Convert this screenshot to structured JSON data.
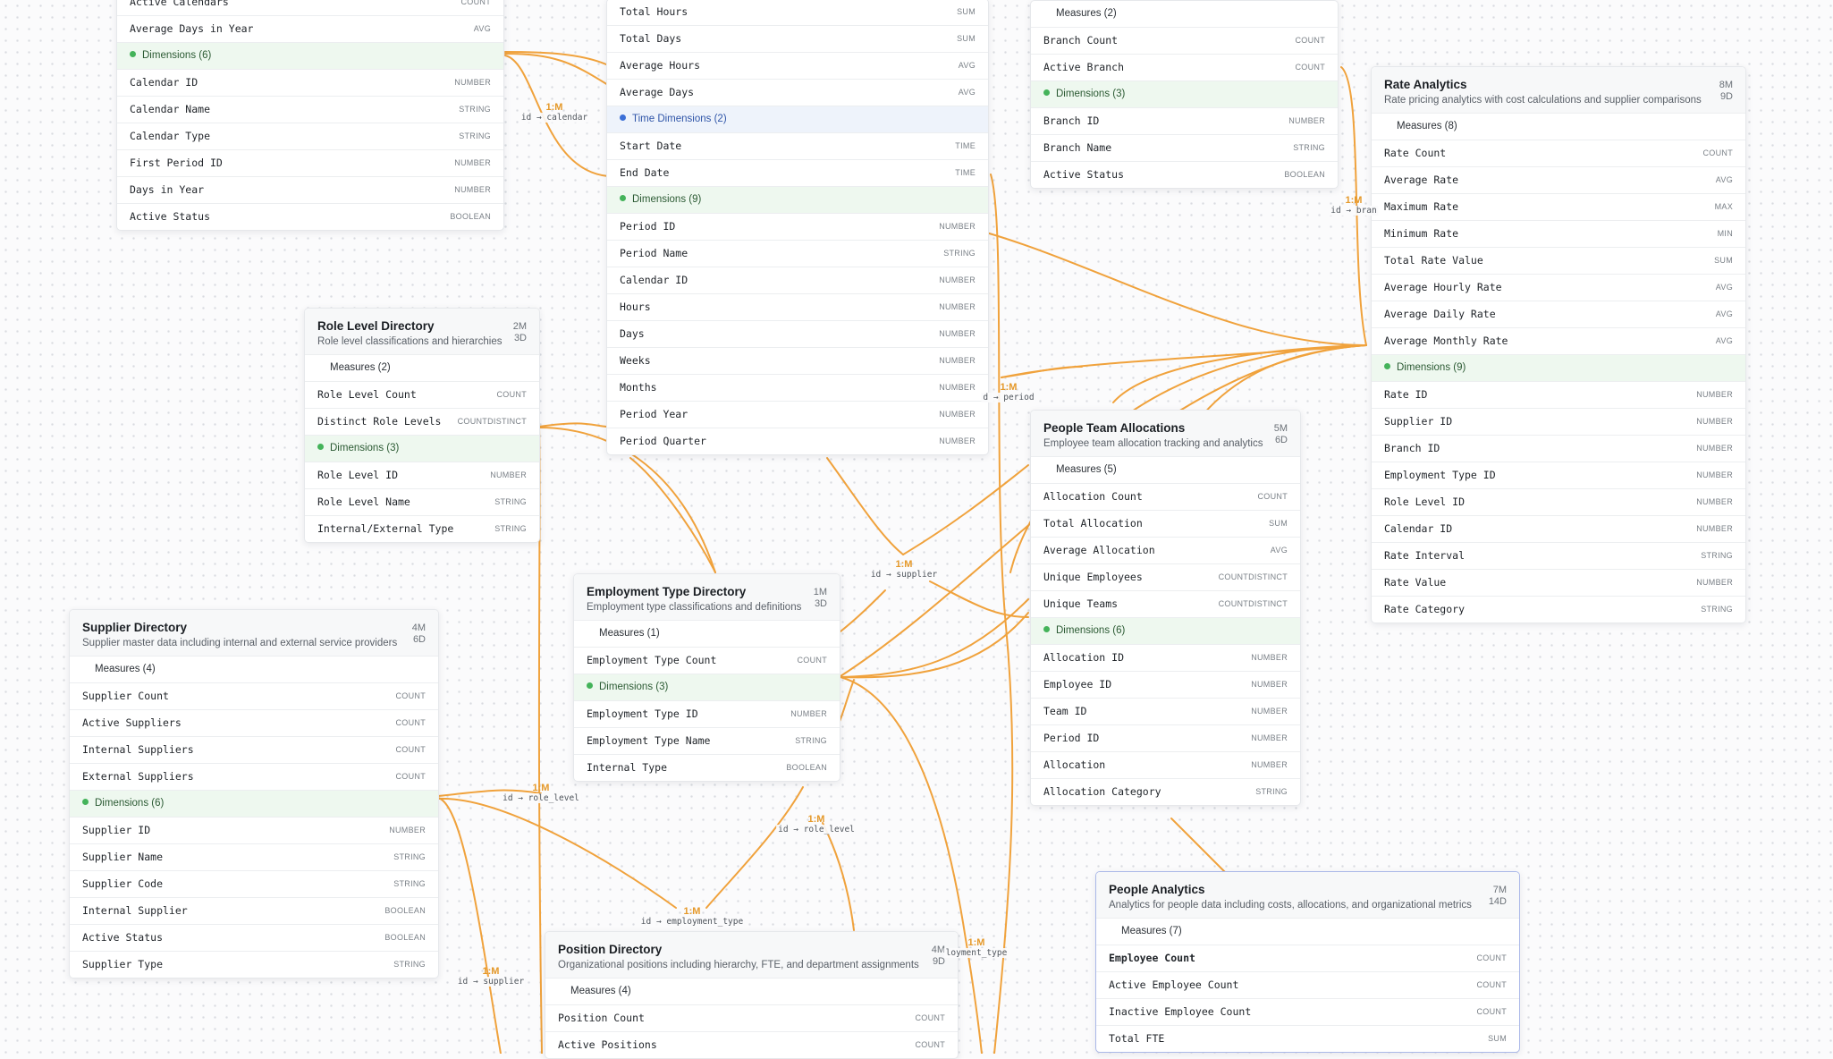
{
  "colors": {
    "edge": "#f0a23c",
    "card_label": "#e5992a",
    "dimension_dot": "#44b35a",
    "time_dot": "#3b6fd6"
  },
  "entities": [
    {
      "id": "calendars",
      "title": "",
      "description": "",
      "counts": [
        "",
        ""
      ],
      "sections": [
        {
          "kind": "plain",
          "label": "",
          "rows": [
            {
              "name": "Active Calendars",
              "type": "COUNT"
            },
            {
              "name": "Average Days in Year",
              "type": "AVG"
            }
          ]
        },
        {
          "kind": "dim",
          "label": "Dimensions (6)",
          "rows": [
            {
              "name": "Calendar ID",
              "type": "NUMBER"
            },
            {
              "name": "Calendar Name",
              "type": "STRING"
            },
            {
              "name": "Calendar Type",
              "type": "STRING"
            },
            {
              "name": "First Period ID",
              "type": "NUMBER"
            },
            {
              "name": "Days in Year",
              "type": "NUMBER"
            },
            {
              "name": "Active Status",
              "type": "BOOLEAN"
            }
          ]
        }
      ]
    },
    {
      "id": "periods",
      "title": "",
      "description": "",
      "counts": [
        "",
        ""
      ],
      "sections": [
        {
          "kind": "plain",
          "label": "",
          "rows": [
            {
              "name": "Total Hours",
              "type": "SUM"
            },
            {
              "name": "Total Days",
              "type": "SUM"
            },
            {
              "name": "Average Hours",
              "type": "AVG"
            },
            {
              "name": "Average Days",
              "type": "AVG"
            }
          ]
        },
        {
          "kind": "time",
          "label": "Time Dimensions (2)",
          "rows": [
            {
              "name": "Start Date",
              "type": "TIME"
            },
            {
              "name": "End Date",
              "type": "TIME"
            }
          ]
        },
        {
          "kind": "dim",
          "label": "Dimensions (9)",
          "rows": [
            {
              "name": "Period ID",
              "type": "NUMBER"
            },
            {
              "name": "Period Name",
              "type": "STRING"
            },
            {
              "name": "Calendar ID",
              "type": "NUMBER"
            },
            {
              "name": "Hours",
              "type": "NUMBER"
            },
            {
              "name": "Days",
              "type": "NUMBER"
            },
            {
              "name": "Weeks",
              "type": "NUMBER"
            },
            {
              "name": "Months",
              "type": "NUMBER"
            },
            {
              "name": "Period Year",
              "type": "NUMBER"
            },
            {
              "name": "Period Quarter",
              "type": "NUMBER"
            }
          ]
        }
      ]
    },
    {
      "id": "branches",
      "title": "",
      "description": "",
      "counts": [
        "",
        ""
      ],
      "sections": [
        {
          "kind": "plain",
          "label": "Measures (2)",
          "rows": [
            {
              "name": "Branch Count",
              "type": "COUNT"
            },
            {
              "name": "Active Branch",
              "type": "COUNT"
            }
          ]
        },
        {
          "kind": "dim",
          "label": "Dimensions (3)",
          "rows": [
            {
              "name": "Branch ID",
              "type": "NUMBER"
            },
            {
              "name": "Branch Name",
              "type": "STRING"
            },
            {
              "name": "Active Status",
              "type": "BOOLEAN"
            }
          ]
        }
      ]
    },
    {
      "id": "rate_analytics",
      "title": "Rate Analytics",
      "description": "Rate pricing analytics with cost calculations and supplier comparisons",
      "counts": [
        "8M",
        "9D"
      ],
      "sections": [
        {
          "kind": "plain",
          "label": "Measures (8)",
          "rows": [
            {
              "name": "Rate Count",
              "type": "COUNT"
            },
            {
              "name": "Average Rate",
              "type": "AVG"
            },
            {
              "name": "Maximum Rate",
              "type": "MAX"
            },
            {
              "name": "Minimum Rate",
              "type": "MIN"
            },
            {
              "name": "Total Rate Value",
              "type": "SUM"
            },
            {
              "name": "Average Hourly Rate",
              "type": "AVG"
            },
            {
              "name": "Average Daily Rate",
              "type": "AVG"
            },
            {
              "name": "Average Monthly Rate",
              "type": "AVG"
            }
          ]
        },
        {
          "kind": "dim",
          "label": "Dimensions (9)",
          "rows": [
            {
              "name": "Rate ID",
              "type": "NUMBER"
            },
            {
              "name": "Supplier ID",
              "type": "NUMBER"
            },
            {
              "name": "Branch ID",
              "type": "NUMBER"
            },
            {
              "name": "Employment Type ID",
              "type": "NUMBER"
            },
            {
              "name": "Role Level ID",
              "type": "NUMBER"
            },
            {
              "name": "Calendar ID",
              "type": "NUMBER"
            },
            {
              "name": "Rate Interval",
              "type": "STRING"
            },
            {
              "name": "Rate Value",
              "type": "NUMBER"
            },
            {
              "name": "Rate Category",
              "type": "STRING"
            }
          ]
        }
      ]
    },
    {
      "id": "role_levels",
      "title": "Role Level Directory",
      "description": "Role level classifications and hierarchies",
      "counts": [
        "2M",
        "3D"
      ],
      "sections": [
        {
          "kind": "plain",
          "label": "Measures (2)",
          "rows": [
            {
              "name": "Role Level Count",
              "type": "COUNT"
            },
            {
              "name": "Distinct Role Levels",
              "type": "COUNTDISTINCT"
            }
          ]
        },
        {
          "kind": "dim",
          "label": "Dimensions (3)",
          "rows": [
            {
              "name": "Role Level ID",
              "type": "NUMBER"
            },
            {
              "name": "Role Level Name",
              "type": "STRING"
            },
            {
              "name": "Internal/External Type",
              "type": "STRING"
            }
          ]
        }
      ]
    },
    {
      "id": "team_allocations",
      "title": "People Team Allocations",
      "description": "Employee team allocation tracking and analytics",
      "counts": [
        "5M",
        "6D"
      ],
      "sections": [
        {
          "kind": "plain",
          "label": "Measures (5)",
          "rows": [
            {
              "name": "Allocation Count",
              "type": "COUNT"
            },
            {
              "name": "Total Allocation",
              "type": "SUM"
            },
            {
              "name": "Average Allocation",
              "type": "AVG"
            },
            {
              "name": "Unique Employees",
              "type": "COUNTDISTINCT"
            },
            {
              "name": "Unique Teams",
              "type": "COUNTDISTINCT"
            }
          ]
        },
        {
          "kind": "dim",
          "label": "Dimensions (6)",
          "rows": [
            {
              "name": "Allocation ID",
              "type": "NUMBER"
            },
            {
              "name": "Employee ID",
              "type": "NUMBER"
            },
            {
              "name": "Team ID",
              "type": "NUMBER"
            },
            {
              "name": "Period ID",
              "type": "NUMBER"
            },
            {
              "name": "Allocation",
              "type": "NUMBER"
            },
            {
              "name": "Allocation Category",
              "type": "STRING"
            }
          ]
        }
      ]
    },
    {
      "id": "employment_types",
      "title": "Employment Type Directory",
      "description": "Employment type classifications and definitions",
      "counts": [
        "1M",
        "3D"
      ],
      "sections": [
        {
          "kind": "plain",
          "label": "Measures (1)",
          "rows": [
            {
              "name": "Employment Type Count",
              "type": "COUNT"
            }
          ]
        },
        {
          "kind": "dim",
          "label": "Dimensions (3)",
          "rows": [
            {
              "name": "Employment Type ID",
              "type": "NUMBER"
            },
            {
              "name": "Employment Type Name",
              "type": "STRING"
            },
            {
              "name": "Internal Type",
              "type": "BOOLEAN"
            }
          ]
        }
      ]
    },
    {
      "id": "suppliers",
      "title": "Supplier Directory",
      "description": "Supplier master data including internal and external service providers",
      "counts": [
        "4M",
        "6D"
      ],
      "sections": [
        {
          "kind": "plain",
          "label": "Measures (4)",
          "rows": [
            {
              "name": "Supplier Count",
              "type": "COUNT"
            },
            {
              "name": "Active Suppliers",
              "type": "COUNT"
            },
            {
              "name": "Internal Suppliers",
              "type": "COUNT"
            },
            {
              "name": "External Suppliers",
              "type": "COUNT"
            }
          ]
        },
        {
          "kind": "dim",
          "label": "Dimensions (6)",
          "rows": [
            {
              "name": "Supplier ID",
              "type": "NUMBER"
            },
            {
              "name": "Supplier Name",
              "type": "STRING"
            },
            {
              "name": "Supplier Code",
              "type": "STRING"
            },
            {
              "name": "Internal Supplier",
              "type": "BOOLEAN"
            },
            {
              "name": "Active Status",
              "type": "BOOLEAN"
            },
            {
              "name": "Supplier Type",
              "type": "STRING"
            }
          ]
        }
      ]
    },
    {
      "id": "positions",
      "title": "Position Directory",
      "description": "Organizational positions including hierarchy, FTE, and department assignments",
      "counts": [
        "4M",
        "9D"
      ],
      "sections": [
        {
          "kind": "plain",
          "label": "Measures (4)",
          "rows": [
            {
              "name": "Position Count",
              "type": "COUNT"
            },
            {
              "name": "Active Positions",
              "type": "COUNT"
            }
          ]
        }
      ]
    },
    {
      "id": "people_analytics",
      "title": "People Analytics",
      "description": "Analytics for people data including costs, allocations, and organizational metrics",
      "counts": [
        "7M",
        "14D"
      ],
      "selected": true,
      "sections": [
        {
          "kind": "plain",
          "label": "Measures (7)",
          "rows": [
            {
              "name": "Employee Count",
              "type": "COUNT",
              "bold": true
            },
            {
              "name": "Active Employee Count",
              "type": "COUNT"
            },
            {
              "name": "Inactive Employee Count",
              "type": "COUNT"
            },
            {
              "name": "Total FTE",
              "type": "SUM"
            }
          ]
        }
      ]
    }
  ],
  "edge_labels": [
    {
      "id": "calendar",
      "card": "1:M",
      "key": "id → calendar"
    },
    {
      "id": "branch",
      "card": "1:M",
      "key": "id → bran"
    },
    {
      "id": "period",
      "card": "1:M",
      "key": "d → period"
    },
    {
      "id": "supplier_mid",
      "card": "1:M",
      "key": "id → supplier"
    },
    {
      "id": "role_level_left",
      "card": "1:M",
      "key": "id → role_level"
    },
    {
      "id": "role_level_right",
      "card": "1:M",
      "key": "id → role_level"
    },
    {
      "id": "employment_type_mid",
      "card": "1:M",
      "key": "id → employment_type"
    },
    {
      "id": "employment_type_right",
      "card": "1:M",
      "key": "loyment_type"
    },
    {
      "id": "supplier_low",
      "card": "1:M",
      "key": "id → supplier"
    }
  ]
}
